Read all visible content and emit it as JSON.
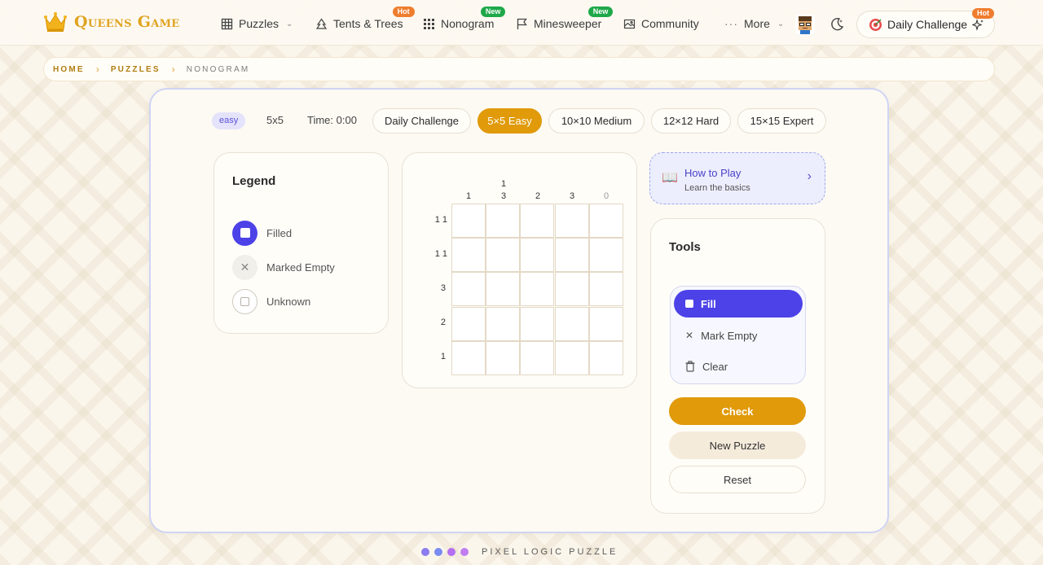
{
  "header": {
    "logo_text": "Queens Game",
    "nav": [
      {
        "label": "Puzzles",
        "icon": "grid-icon",
        "dropdown": true
      },
      {
        "label": "Tents & Trees",
        "icon": "tent-icon",
        "badge": "Hot"
      },
      {
        "label": "Nonogram",
        "icon": "dots-grid-icon",
        "badge": "New"
      },
      {
        "label": "Minesweeper",
        "icon": "flag-icon",
        "badge": "New"
      },
      {
        "label": "Community",
        "icon": "image-icon"
      },
      {
        "label": "More",
        "icon": "more-icon",
        "dropdown": true
      }
    ],
    "daily_challenge": {
      "label": "Daily Challenge",
      "badge": "Hot"
    }
  },
  "breadcrumb": [
    "HOME",
    "PUZZLES",
    "NONOGRAM"
  ],
  "game_bar": {
    "difficulty_pill": "easy",
    "size": "5x5",
    "time": "Time: 0:00",
    "modes": [
      "Daily Challenge",
      "5×5 Easy",
      "10×10 Medium",
      "12×12 Hard",
      "15×15 Expert"
    ],
    "active_mode": "5×5 Easy"
  },
  "legend": {
    "title": "Legend",
    "items": [
      {
        "label": "Filled",
        "icon": "filled-square-icon"
      },
      {
        "label": "Marked Empty",
        "icon": "x-icon"
      },
      {
        "label": "Unknown",
        "icon": "empty-square-icon"
      }
    ]
  },
  "puzzle": {
    "size": 5,
    "column_clues": [
      [
        "1"
      ],
      [
        "1",
        "3"
      ],
      [
        "2"
      ],
      [
        "3"
      ],
      [
        "0"
      ]
    ],
    "row_clues": [
      "1 1",
      "1 1",
      "3",
      "2",
      "1"
    ]
  },
  "how_to_play": {
    "title": "How to Play",
    "subtitle": "Learn the basics"
  },
  "tools": {
    "title": "Tools",
    "items": [
      {
        "label": "Fill",
        "icon": "square-icon",
        "active": true
      },
      {
        "label": "Mark Empty",
        "icon": "x-icon"
      },
      {
        "label": "Clear",
        "icon": "trash-icon"
      }
    ],
    "check": "Check",
    "new_puzzle": "New Puzzle",
    "reset": "Reset"
  },
  "footer": {
    "text": "PIXEL LOGIC PUZZLE",
    "dot_colors": [
      "#8b7cf0",
      "#7a8cf2",
      "#b46ff0",
      "#c07df0"
    ]
  },
  "colors": {
    "accent_purple": "#4c42e8",
    "accent_orange": "#e09a0a",
    "logo_gold": "#e0a420"
  }
}
